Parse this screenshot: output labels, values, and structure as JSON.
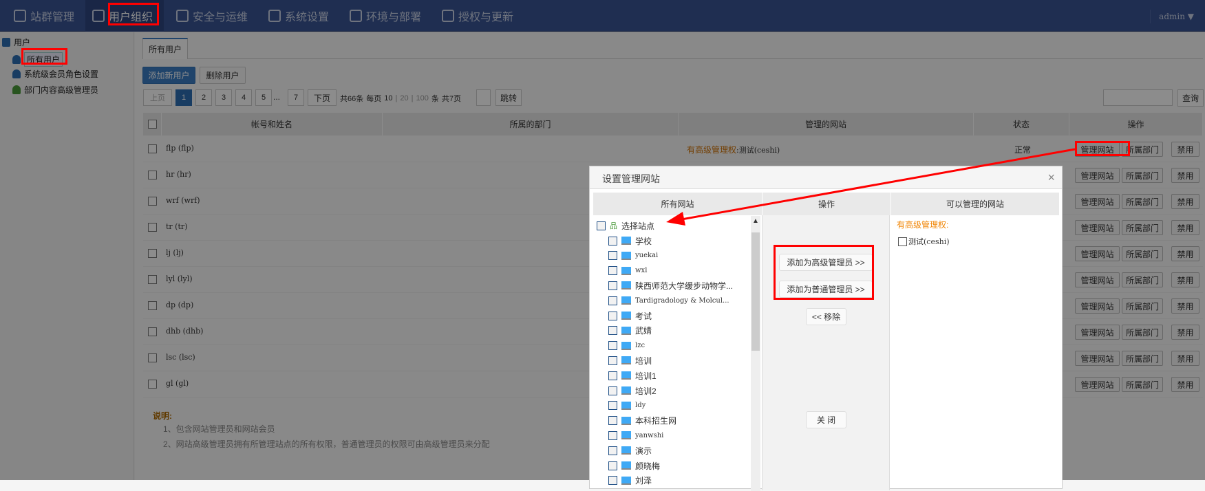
{
  "nav": {
    "items": [
      {
        "label": "站群管理",
        "icon": "sites-icon"
      },
      {
        "label": "用户组织",
        "icon": "user-card-icon",
        "active": true
      },
      {
        "label": "安全与运维",
        "icon": "shield-icon"
      },
      {
        "label": "系统设置",
        "icon": "settings-icon"
      },
      {
        "label": "环境与部署",
        "icon": "deploy-icon"
      },
      {
        "label": "授权与更新",
        "icon": "license-icon"
      }
    ],
    "user": "admin ▼"
  },
  "sidebar": {
    "root": "用户",
    "items": [
      "所有用户",
      "系统级会员角色设置",
      "部门内容高级管理员"
    ]
  },
  "main": {
    "tab": "所有用户",
    "add_btn": "添加新用户",
    "del_btn": "删除用户",
    "pager": {
      "prev": "上页",
      "pages": [
        "1",
        "2",
        "3",
        "4",
        "5"
      ],
      "ellipsis": "...",
      "last": "7",
      "next": "下页",
      "total": "共66条",
      "per_page": "每页",
      "sizes": [
        "10",
        "20",
        "100"
      ],
      "unit": "条",
      "total_pages": "共7页",
      "jump": "跳转"
    },
    "search_btn": "查询",
    "table": {
      "headers": [
        "帐号和姓名",
        "所属的部门",
        "管理的网站",
        "状态",
        "操作"
      ],
      "rows": [
        {
          "name": "flp (flp)",
          "site_label": "有高级管理权",
          "site": ":测试(ceshi)",
          "status": "正常"
        },
        {
          "name": "hr (hr)"
        },
        {
          "name": "wrf (wrf)"
        },
        {
          "name": "tr (tr)"
        },
        {
          "name": "lj (lj)"
        },
        {
          "name": "lyl (lyl)"
        },
        {
          "name": "dp (dp)"
        },
        {
          "name": "dhb (dhb)"
        },
        {
          "name": "lsc (lsc)"
        },
        {
          "name": "gl (gl)"
        }
      ],
      "ops": [
        "管理网站",
        "所属部门",
        "禁用"
      ]
    },
    "notes": {
      "title": "说明:",
      "lines": [
        "1、包含网站管理员和网站会员",
        "2、网站高级管理员拥有所管理站点的所有权限，普通管理员的权限可由高级管理员来分配"
      ]
    }
  },
  "dialog": {
    "title": "设置管理网站",
    "close": "×",
    "headers": [
      "所有网站",
      "操作",
      "可以管理的网站"
    ],
    "root": "选择站点",
    "sites": [
      "学校",
      "yuekai",
      "wxl",
      "陕西师范大学缓步动物学...",
      "Tardigradology & Molcul...",
      "考试",
      "武婧",
      "lzc",
      "培训",
      "培训1",
      "培训2",
      "ldy",
      "本科招生网",
      "yanwshi",
      "演示",
      "颜晓梅",
      "刘泽"
    ],
    "add_senior": "添加为高级管理员 >>",
    "add_normal": "添加为普通管理员 >>",
    "remove": "<< 移除",
    "close_btn": "关 闭",
    "senior_label": "有高级管理权:",
    "managed": [
      "测试(ceshi)"
    ]
  },
  "colors": {
    "nav": "#3a5494",
    "accent": "#3b7cc4",
    "orange": "#f08300",
    "annotation": "#ff0000"
  }
}
